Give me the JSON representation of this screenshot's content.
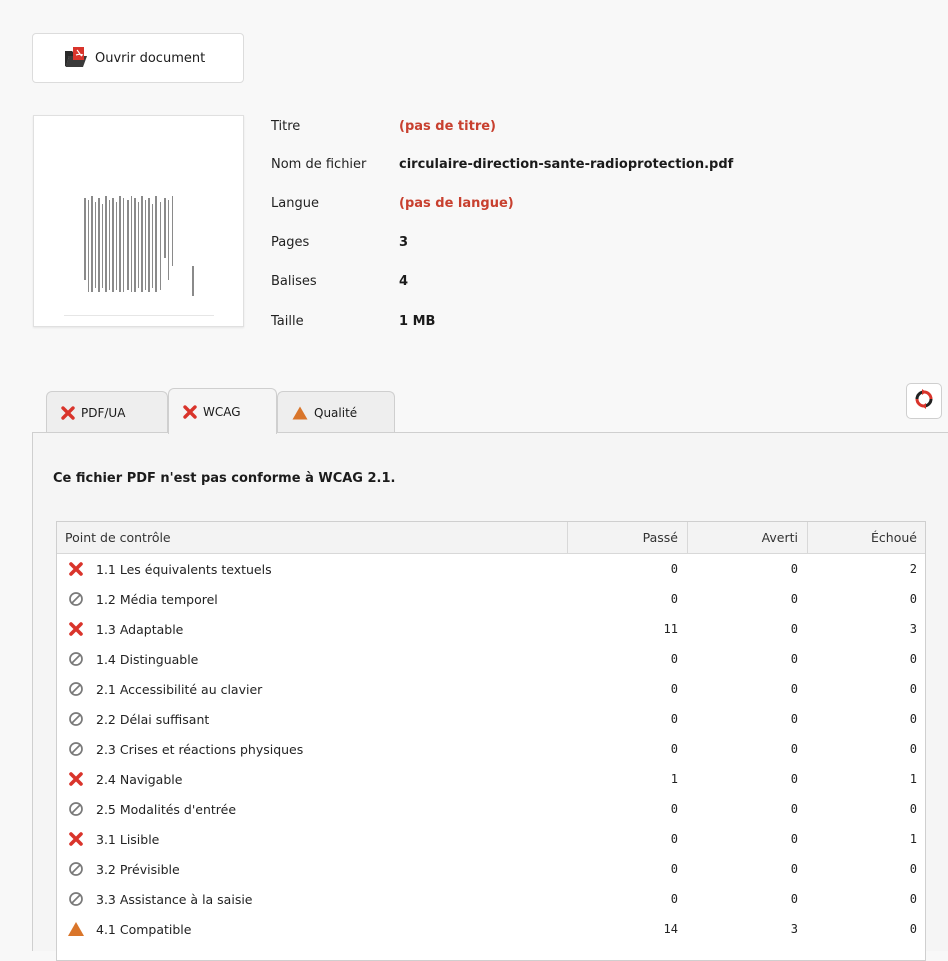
{
  "toolbar": {
    "open_label": "Ouvrir document"
  },
  "document": {
    "fields": [
      {
        "key": "Titre",
        "value": "(pas de titre)",
        "missing": true
      },
      {
        "key": "Nom de fichier",
        "value": "circulaire-direction-sante-radioprotection.pdf",
        "missing": false
      },
      {
        "key": "Langue",
        "value": "(pas de langue)",
        "missing": true
      },
      {
        "key": "Pages",
        "value": "3",
        "missing": false
      },
      {
        "key": "Balises",
        "value": "4",
        "missing": false
      },
      {
        "key": "Taille",
        "value": "1 MB",
        "missing": false
      }
    ]
  },
  "tabs": [
    {
      "label": "PDF/UA",
      "icon": "fail-x-icon",
      "active": false
    },
    {
      "label": "WCAG",
      "icon": "fail-x-icon",
      "active": true
    },
    {
      "label": "Qualité",
      "icon": "warning-triangle-icon",
      "active": false
    }
  ],
  "panel": {
    "verdict": "Ce fichier PDF n'est pas conforme à WCAG 2.1."
  },
  "table": {
    "columns": [
      "Point de contrôle",
      "Passé",
      "Averti",
      "Échoué"
    ],
    "rows": [
      {
        "status": "fail",
        "label": "1.1 Les équivalents textuels",
        "passed": "0",
        "warned": "0",
        "failed": "2"
      },
      {
        "status": "na",
        "label": "1.2 Média temporel",
        "passed": "0",
        "warned": "0",
        "failed": "0"
      },
      {
        "status": "fail",
        "label": "1.3 Adaptable",
        "passed": "11",
        "warned": "0",
        "failed": "3"
      },
      {
        "status": "na",
        "label": "1.4 Distinguable",
        "passed": "0",
        "warned": "0",
        "failed": "0"
      },
      {
        "status": "na",
        "label": "2.1 Accessibilité au clavier",
        "passed": "0",
        "warned": "0",
        "failed": "0"
      },
      {
        "status": "na",
        "label": "2.2 Délai suffisant",
        "passed": "0",
        "warned": "0",
        "failed": "0"
      },
      {
        "status": "na",
        "label": "2.3 Crises et réactions physiques",
        "passed": "0",
        "warned": "0",
        "failed": "0"
      },
      {
        "status": "fail",
        "label": "2.4 Navigable",
        "passed": "1",
        "warned": "0",
        "failed": "1"
      },
      {
        "status": "na",
        "label": "2.5 Modalités d'entrée",
        "passed": "0",
        "warned": "0",
        "failed": "0"
      },
      {
        "status": "fail",
        "label": "3.1 Lisible",
        "passed": "0",
        "warned": "0",
        "failed": "1"
      },
      {
        "status": "na",
        "label": "3.2 Prévisible",
        "passed": "0",
        "warned": "0",
        "failed": "0"
      },
      {
        "status": "na",
        "label": "3.3 Assistance à la saisie",
        "passed": "0",
        "warned": "0",
        "failed": "0"
      },
      {
        "status": "warn",
        "label": "4.1 Compatible",
        "passed": "14",
        "warned": "3",
        "failed": "0"
      }
    ]
  },
  "colors": {
    "fail": "#d9342b",
    "warn": "#d9752a",
    "na": "#7a7a7a",
    "missing_text": "#c8402f"
  },
  "icons": {
    "open": "folder-pdf-icon",
    "refresh": "refresh-icon",
    "status": {
      "fail": "fail-x-icon",
      "na": "not-applicable-icon",
      "warn": "warning-triangle-icon"
    }
  }
}
